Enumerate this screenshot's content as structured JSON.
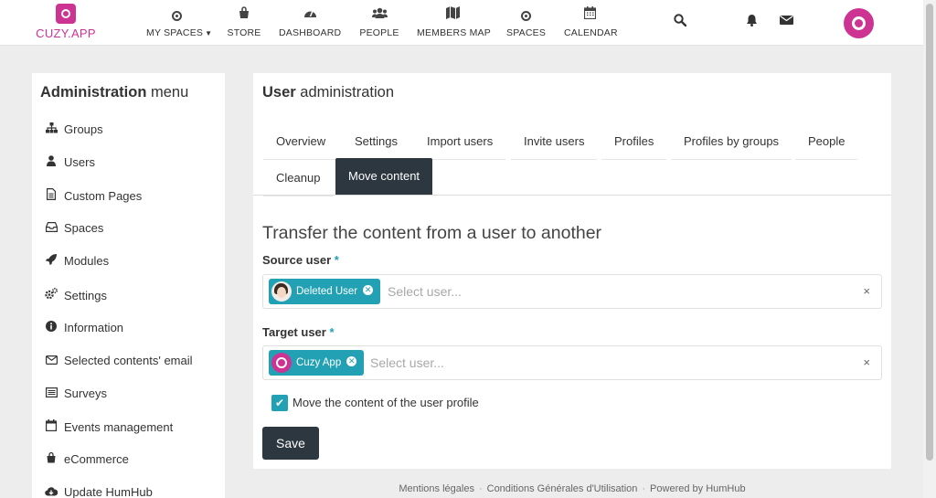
{
  "brand": {
    "logo_text": "CUZY.APP",
    "color": "#cc3393"
  },
  "topnav": {
    "items": [
      {
        "label": "MY SPACES",
        "icon": "target-icon",
        "has_caret": true
      },
      {
        "label": "STORE",
        "icon": "shopping-bag-icon"
      },
      {
        "label": "DASHBOARD",
        "icon": "tachometer-icon"
      },
      {
        "label": "PEOPLE",
        "icon": "users-icon"
      },
      {
        "label": "MEMBERS MAP",
        "icon": "map-icon"
      },
      {
        "label": "SPACES",
        "icon": "target-icon"
      },
      {
        "label": "CALENDAR",
        "icon": "calendar-icon"
      }
    ],
    "utility_icons": [
      "search-icon",
      "bell-icon",
      "envelope-icon"
    ]
  },
  "sidebar": {
    "title_bold": "Administration",
    "title_rest": " menu",
    "items": [
      {
        "label": "Groups",
        "icon": "sitemap-icon"
      },
      {
        "label": "Users",
        "icon": "user-icon"
      },
      {
        "label": "Custom Pages",
        "icon": "file-icon"
      },
      {
        "label": "Spaces",
        "icon": "inbox-icon"
      },
      {
        "label": "Modules",
        "icon": "rocket-icon"
      },
      {
        "label": "Settings",
        "icon": "cogs-icon"
      },
      {
        "label": "Information",
        "icon": "info-circle-icon"
      },
      {
        "label": "Selected contents' email",
        "icon": "envelope-outline-icon"
      },
      {
        "label": "Surveys",
        "icon": "list-icon"
      },
      {
        "label": "Events management",
        "icon": "calendar-icon"
      },
      {
        "label": "eCommerce",
        "icon": "shopping-bag-icon"
      },
      {
        "label": "Update HumHub",
        "icon": "cloud-download-icon"
      }
    ]
  },
  "main": {
    "title_bold": "User",
    "title_rest": " administration",
    "tabs": [
      {
        "label": "Overview"
      },
      {
        "label": "Settings"
      },
      {
        "label": "Import users"
      },
      {
        "label": "Invite users"
      },
      {
        "label": "Profiles"
      },
      {
        "label": "Profiles by groups"
      },
      {
        "label": "People"
      },
      {
        "label": "Cleanup"
      },
      {
        "label": "Move content",
        "active": true
      }
    ],
    "section_title": "Transfer the content from a user to another",
    "source": {
      "label": "Source user",
      "required_mark": "*",
      "chip": "Deleted User",
      "placeholder": "Select user...",
      "clear": "×"
    },
    "target": {
      "label": "Target user",
      "required_mark": "*",
      "chip": "Cuzy App",
      "placeholder": "Select user...",
      "clear": "×"
    },
    "checkbox": {
      "label": "Move the content of the user profile",
      "checked": true
    },
    "save_label": "Save",
    "accent": "#21a1b3",
    "dark": "#2d3740"
  },
  "footer": {
    "links": [
      "Mentions légales",
      "Conditions Générales d'Utilisation",
      "Powered by HumHub"
    ],
    "separator": "·"
  }
}
